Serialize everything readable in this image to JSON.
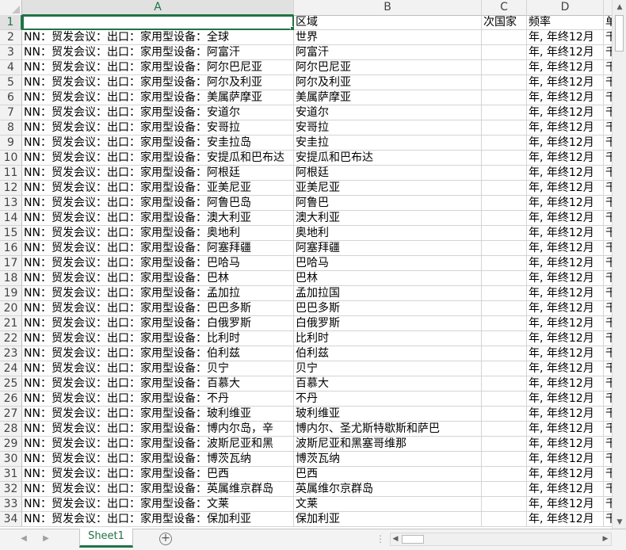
{
  "columns": [
    "A",
    "B",
    "C",
    "D"
  ],
  "rows": [
    {
      "n": "1",
      "a": "",
      "b": "区域",
      "c": "次国家",
      "d": "频率",
      "e": "单"
    },
    {
      "n": "2",
      "a": "NN：贸发会议：出口：家用型设备：全球",
      "b": "世界",
      "c": "",
      "d": "年, 年终12月",
      "e": "千"
    },
    {
      "n": "3",
      "a": "NN：贸发会议：出口：家用型设备：阿富汗",
      "b": "阿富汗",
      "c": "",
      "d": "年, 年终12月",
      "e": "千"
    },
    {
      "n": "4",
      "a": "NN：贸发会议：出口：家用型设备：阿尔巴尼亚",
      "b": "阿尔巴尼亚",
      "c": "",
      "d": "年, 年终12月",
      "e": "千"
    },
    {
      "n": "5",
      "a": "NN：贸发会议：出口：家用型设备：阿尔及利亚",
      "b": "阿尔及利亚",
      "c": "",
      "d": "年, 年终12月",
      "e": "千"
    },
    {
      "n": "6",
      "a": "NN：贸发会议：出口：家用型设备：美属萨摩亚",
      "b": "美属萨摩亚",
      "c": "",
      "d": "年, 年终12月",
      "e": "千"
    },
    {
      "n": "7",
      "a": "NN：贸发会议：出口：家用型设备：安道尔",
      "b": "安道尔",
      "c": "",
      "d": "年, 年终12月",
      "e": "千"
    },
    {
      "n": "8",
      "a": "NN：贸发会议：出口：家用型设备：安哥拉",
      "b": "安哥拉",
      "c": "",
      "d": "年, 年终12月",
      "e": "千"
    },
    {
      "n": "9",
      "a": "NN：贸发会议：出口：家用型设备：安圭拉岛",
      "b": "安圭拉",
      "c": "",
      "d": "年, 年终12月",
      "e": "千"
    },
    {
      "n": "10",
      "a": "NN：贸发会议：出口：家用型设备：安提瓜和巴布达",
      "b": "安提瓜和巴布达",
      "c": "",
      "d": "年, 年终12月",
      "e": "千"
    },
    {
      "n": "11",
      "a": "NN：贸发会议：出口：家用型设备：阿根廷",
      "b": "阿根廷",
      "c": "",
      "d": "年, 年终12月",
      "e": "千"
    },
    {
      "n": "12",
      "a": "NN：贸发会议：出口：家用型设备：亚美尼亚",
      "b": "亚美尼亚",
      "c": "",
      "d": "年, 年终12月",
      "e": "千"
    },
    {
      "n": "13",
      "a": "NN：贸发会议：出口：家用型设备：阿鲁巴岛",
      "b": "阿鲁巴",
      "c": "",
      "d": "年, 年终12月",
      "e": "千"
    },
    {
      "n": "14",
      "a": "NN：贸发会议：出口：家用型设备：澳大利亚",
      "b": "澳大利亚",
      "c": "",
      "d": "年, 年终12月",
      "e": "千"
    },
    {
      "n": "15",
      "a": "NN：贸发会议：出口：家用型设备：奥地利",
      "b": "奥地利",
      "c": "",
      "d": "年, 年终12月",
      "e": "千"
    },
    {
      "n": "16",
      "a": "NN：贸发会议：出口：家用型设备：阿塞拜疆",
      "b": "阿塞拜疆",
      "c": "",
      "d": "年, 年终12月",
      "e": "千"
    },
    {
      "n": "17",
      "a": "NN：贸发会议：出口：家用型设备：巴哈马",
      "b": "巴哈马",
      "c": "",
      "d": "年, 年终12月",
      "e": "千"
    },
    {
      "n": "18",
      "a": "NN：贸发会议：出口：家用型设备：巴林",
      "b": "巴林",
      "c": "",
      "d": "年, 年终12月",
      "e": "千"
    },
    {
      "n": "19",
      "a": "NN：贸发会议：出口：家用型设备：孟加拉",
      "b": "孟加拉国",
      "c": "",
      "d": "年, 年终12月",
      "e": "千"
    },
    {
      "n": "20",
      "a": "NN：贸发会议：出口：家用型设备：巴巴多斯",
      "b": "巴巴多斯",
      "c": "",
      "d": "年, 年终12月",
      "e": "千"
    },
    {
      "n": "21",
      "a": "NN：贸发会议：出口：家用型设备：白俄罗斯",
      "b": "白俄罗斯",
      "c": "",
      "d": "年, 年终12月",
      "e": "千"
    },
    {
      "n": "22",
      "a": "NN：贸发会议：出口：家用型设备：比利时",
      "b": "比利时",
      "c": "",
      "d": "年, 年终12月",
      "e": "千"
    },
    {
      "n": "23",
      "a": "NN：贸发会议：出口：家用型设备：伯利兹",
      "b": "伯利兹",
      "c": "",
      "d": "年, 年终12月",
      "e": "千"
    },
    {
      "n": "24",
      "a": "NN：贸发会议：出口：家用型设备：贝宁",
      "b": "贝宁",
      "c": "",
      "d": "年, 年终12月",
      "e": "千"
    },
    {
      "n": "25",
      "a": "NN：贸发会议：出口：家用型设备：百慕大",
      "b": "百慕大",
      "c": "",
      "d": "年, 年终12月",
      "e": "千"
    },
    {
      "n": "26",
      "a": "NN：贸发会议：出口：家用型设备：不丹",
      "b": "不丹",
      "c": "",
      "d": "年, 年终12月",
      "e": "千"
    },
    {
      "n": "27",
      "a": "NN：贸发会议：出口：家用型设备：玻利维亚",
      "b": "玻利维亚",
      "c": "",
      "d": "年, 年终12月",
      "e": "千"
    },
    {
      "n": "28",
      "a": "NN：贸发会议：出口：家用型设备：博内尔岛，辛",
      "b": "博内尔、圣尤斯特歇斯和萨巴",
      "c": "",
      "d": "年, 年终12月",
      "e": "千"
    },
    {
      "n": "29",
      "a": "NN：贸发会议：出口：家用型设备：波斯尼亚和黑",
      "b": "波斯尼亚和黑塞哥维那",
      "c": "",
      "d": "年, 年终12月",
      "e": "千"
    },
    {
      "n": "30",
      "a": "NN：贸发会议：出口：家用型设备：博茨瓦纳",
      "b": "博茨瓦纳",
      "c": "",
      "d": "年, 年终12月",
      "e": "千"
    },
    {
      "n": "31",
      "a": "NN：贸发会议：出口：家用型设备：巴西",
      "b": "巴西",
      "c": "",
      "d": "年, 年终12月",
      "e": "千"
    },
    {
      "n": "32",
      "a": "NN：贸发会议：出口：家用型设备：英属维京群岛",
      "b": "英属维尔京群岛",
      "c": "",
      "d": "年, 年终12月",
      "e": "千"
    },
    {
      "n": "33",
      "a": "NN：贸发会议：出口：家用型设备：文莱",
      "b": "文莱",
      "c": "",
      "d": "年, 年终12月",
      "e": "千"
    },
    {
      "n": "34",
      "a": "NN：贸发会议：出口：家用型设备：保加利亚",
      "b": "保加利亚",
      "c": "",
      "d": "年, 年终12月",
      "e": "千"
    }
  ],
  "sheet_tab": "Sheet1",
  "add_sheet_symbol": "+",
  "colors": {
    "accent": "#217346",
    "header_bg": "#f2f2f2",
    "grid": "#d4d4d4"
  }
}
